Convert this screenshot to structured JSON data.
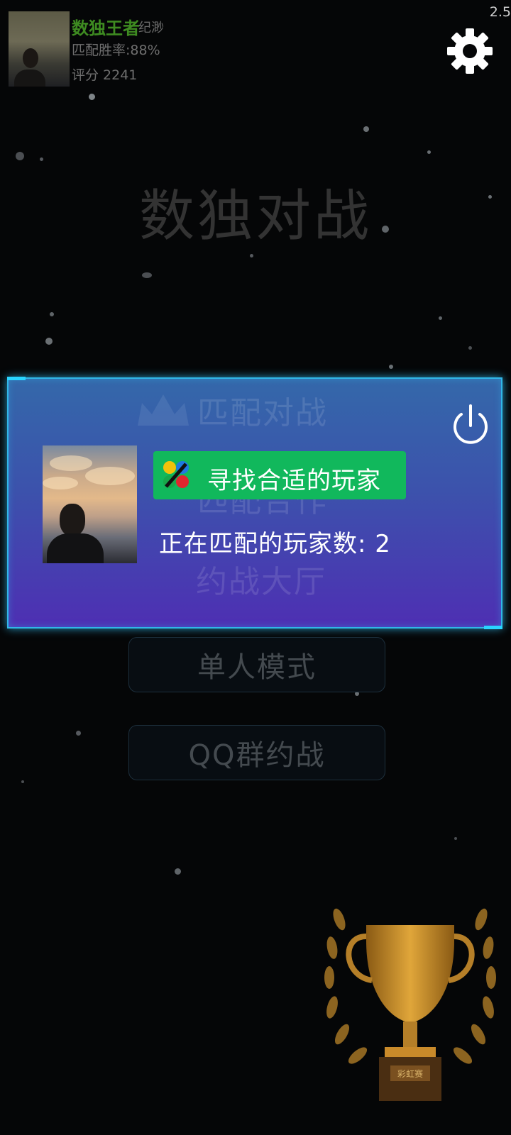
{
  "status": {
    "corner_number": "2.5"
  },
  "profile": {
    "title": "数独王者",
    "nickname": "纪渺",
    "win_rate": "匹配胜率:88%",
    "score": "评分  2241"
  },
  "game": {
    "title": "数独对战"
  },
  "menu": {
    "items": [
      {
        "label": "匹配对战"
      },
      {
        "label": "匹配合作"
      },
      {
        "label": "约战大厅"
      },
      {
        "label": "单人模式"
      },
      {
        "label": "QQ群约战"
      }
    ]
  },
  "matching": {
    "search_label": "寻找合适的玩家",
    "player_count_label": "正在匹配的玩家数: 2"
  },
  "trophy": {
    "plate": "彩虹赛"
  },
  "colors": {
    "panel_border": "#31b7e8",
    "search_green": "#11b85c",
    "profile_name": "#3e8b21",
    "trophy_gold": "#c98a2a"
  },
  "icons": [
    "gear-icon",
    "power-icon",
    "search-logo-icon",
    "crown-icon",
    "trophy-icon"
  ]
}
